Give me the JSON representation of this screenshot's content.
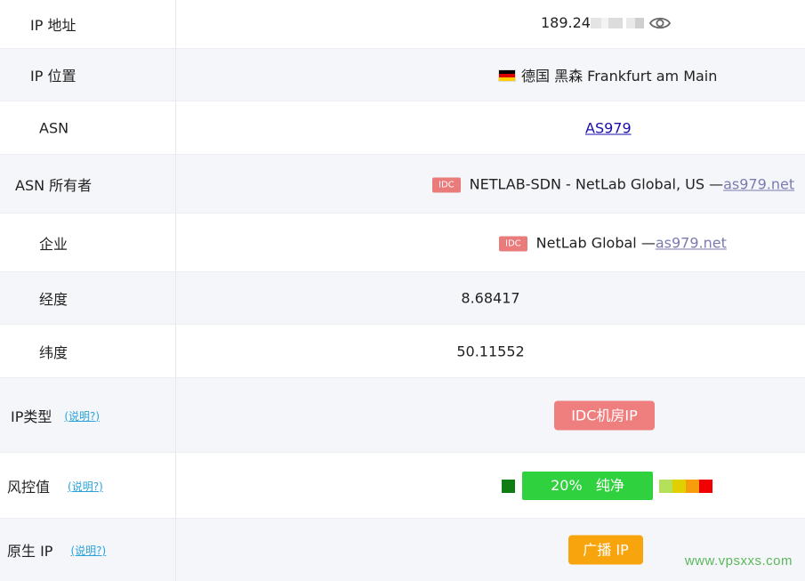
{
  "rows": {
    "ip": {
      "label": "IP 地址",
      "value": "189.24"
    },
    "location": {
      "label": "IP 位置",
      "value": "德国 黑森 Frankfurt am Main"
    },
    "asn": {
      "label": "ASN",
      "value": "AS979"
    },
    "asn_owner": {
      "label": "ASN 所有者",
      "tag": "IDC",
      "value": "NETLAB-SDN - NetLab Global, US —",
      "link": "as979.net"
    },
    "company": {
      "label": "企业",
      "tag": "IDC",
      "value": "NetLab Global —",
      "link": "as979.net"
    },
    "longitude": {
      "label": "经度",
      "value": "8.68417"
    },
    "latitude": {
      "label": "纬度",
      "value": "50.11552"
    },
    "ip_type": {
      "label": "IP类型",
      "help": "(说明?)",
      "value": "IDC机房IP"
    },
    "risk": {
      "label": "风控值",
      "help": "(说明?)",
      "value": "20%   纯净",
      "percent": 20
    },
    "native": {
      "label": "原生 IP",
      "help": "(说明?)",
      "value": "广播 IP"
    }
  },
  "colors": {
    "idc_tag": "#e97b7b",
    "risk_low": "#2fd13e",
    "broadcast": "#f7a40d",
    "risk_scale": [
      "#b4e05a",
      "#e0d000",
      "#f79c0d",
      "#f00000"
    ]
  },
  "icons": {
    "eye": "eye-icon",
    "flag": "germany-flag-icon"
  },
  "watermark": "www.vpsxxs.com"
}
